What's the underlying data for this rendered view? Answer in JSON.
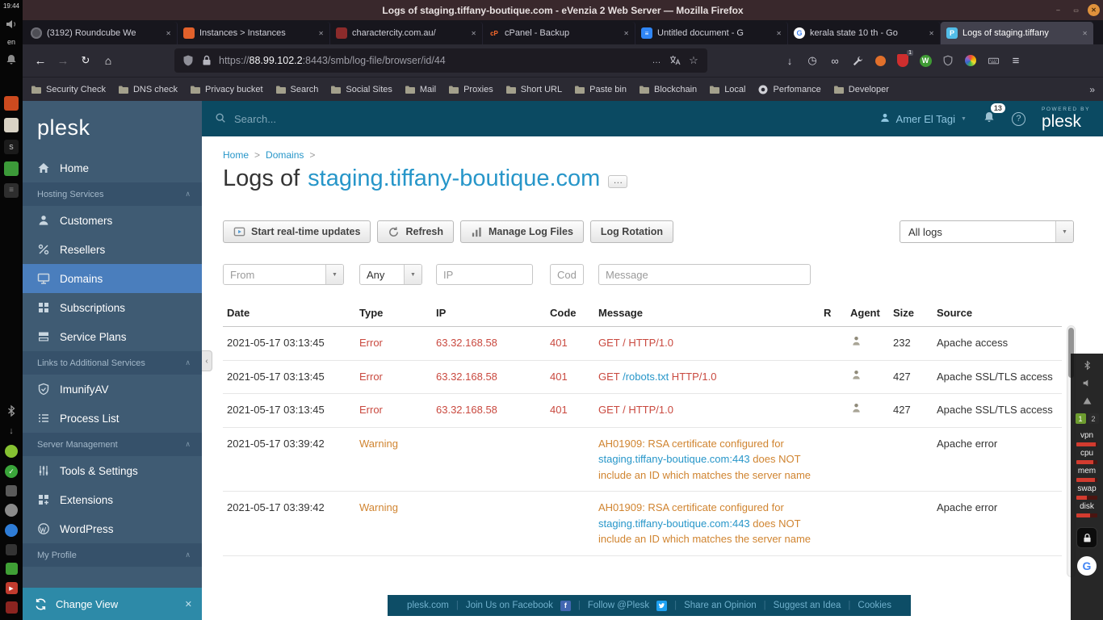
{
  "system": {
    "clock": "19:44",
    "keyboard_language": "en",
    "workspaces": [
      "1",
      "2"
    ],
    "monitor_labels": [
      "vpn",
      "cpu",
      "mem",
      "swap",
      "disk"
    ]
  },
  "browser": {
    "window_title": "Logs of staging.tiffany-boutique.com - eVenzia 2 Web Server — Mozilla Firefox",
    "tabs": [
      {
        "icon": "roundcube",
        "label": "(3192) Roundcube We"
      },
      {
        "icon": "instances",
        "label": "Instances > Instances"
      },
      {
        "icon": "charactercity",
        "label": "charactercity.com.au/"
      },
      {
        "icon": "cpanel",
        "label": "cPanel - Backup"
      },
      {
        "icon": "gdocs",
        "label": "Untitled document - G"
      },
      {
        "icon": "google",
        "label": "kerala state 10 th - Go"
      },
      {
        "icon": "plesk",
        "label": "Logs of staging.tiffany",
        "active": true
      }
    ],
    "url": {
      "scheme": "https://",
      "host": "88.99.102.2",
      "rest": ":8443/smb/log-file/browser/id/44"
    },
    "ublock_badge": "1",
    "bookmarks": [
      {
        "icon": "folder",
        "label": "Security Check"
      },
      {
        "icon": "folder",
        "label": "DNS check"
      },
      {
        "icon": "folder",
        "label": "Privacy bucket"
      },
      {
        "icon": "folder",
        "label": "Search"
      },
      {
        "icon": "folder",
        "label": "Social Sites"
      },
      {
        "icon": "folder",
        "label": "Mail"
      },
      {
        "icon": "folder",
        "label": "Proxies"
      },
      {
        "icon": "folder",
        "label": "Short URL"
      },
      {
        "icon": "folder",
        "label": "Paste bin"
      },
      {
        "icon": "folder",
        "label": "Blockchain"
      },
      {
        "icon": "folder",
        "label": "Local"
      },
      {
        "icon": "github",
        "label": "Perfomance"
      },
      {
        "icon": "folder",
        "label": "Developer"
      }
    ]
  },
  "plesk": {
    "brand": "plesk",
    "sidebar": [
      {
        "type": "item",
        "icon": "home",
        "label": "Home"
      },
      {
        "type": "section",
        "label": "Hosting Services"
      },
      {
        "type": "item",
        "icon": "customers",
        "label": "Customers"
      },
      {
        "type": "item",
        "icon": "resellers",
        "label": "Resellers"
      },
      {
        "type": "item",
        "icon": "domains",
        "label": "Domains",
        "active": true
      },
      {
        "type": "item",
        "icon": "subscriptions",
        "label": "Subscriptions"
      },
      {
        "type": "item",
        "icon": "plans",
        "label": "Service Plans"
      },
      {
        "type": "section",
        "label": "Links to Additional Services"
      },
      {
        "type": "item",
        "icon": "imunify",
        "label": "ImunifyAV"
      },
      {
        "type": "item",
        "icon": "process",
        "label": "Process List"
      },
      {
        "type": "section",
        "label": "Server Management"
      },
      {
        "type": "item",
        "icon": "tools",
        "label": "Tools & Settings"
      },
      {
        "type": "item",
        "icon": "extensions",
        "label": "Extensions"
      },
      {
        "type": "item",
        "icon": "wordpress",
        "label": "WordPress"
      },
      {
        "type": "section",
        "label": "My Profile"
      }
    ],
    "change_view_label": "Change View",
    "header": {
      "search_placeholder": "Search...",
      "user_name": "Amer El Tagi",
      "notification_count": "13",
      "powered_by": "POWERED BY",
      "powered_brand": "plesk"
    },
    "breadcrumb": [
      {
        "label": "Home"
      },
      {
        "label": "Domains"
      }
    ],
    "page_title": {
      "prefix": "Logs of",
      "domain": "staging.tiffany-boutique.com"
    },
    "toolbar_buttons": [
      {
        "icon": "realtime",
        "label": "Start real-time updates"
      },
      {
        "icon": "refresh",
        "label": "Refresh"
      },
      {
        "icon": "managelogs",
        "label": "Manage Log Files"
      },
      {
        "icon": null,
        "label": "Log Rotation"
      }
    ],
    "log_type_select": {
      "value": "All logs"
    },
    "filter_placeholders": {
      "from": "From",
      "type": "Any",
      "ip": "IP",
      "code": "Code",
      "message": "Message"
    },
    "table": {
      "headers": [
        "Date",
        "Type",
        "IP",
        "Code",
        "Message",
        "R",
        "Agent",
        "Size",
        "Source"
      ],
      "rows": [
        {
          "date": "2021-05-17 03:13:45",
          "level": "error",
          "type": "Error",
          "ip": "63.32.168.58",
          "code": "401",
          "message": [
            {
              "style": "error",
              "text": "GET / HTTP/1.0"
            }
          ],
          "agent": true,
          "size": "232",
          "source": "Apache access"
        },
        {
          "date": "2021-05-17 03:13:45",
          "level": "error",
          "type": "Error",
          "ip": "63.32.168.58",
          "code": "401",
          "message": [
            {
              "style": "error",
              "text": "GET "
            },
            {
              "style": "link",
              "text": "/robots.txt"
            },
            {
              "style": "error",
              "text": " HTTP/1.0"
            }
          ],
          "agent": true,
          "size": "427",
          "source": "Apache SSL/TLS access"
        },
        {
          "date": "2021-05-17 03:13:45",
          "level": "error",
          "type": "Error",
          "ip": "63.32.168.58",
          "code": "401",
          "message": [
            {
              "style": "error",
              "text": "GET / HTTP/1.0"
            }
          ],
          "agent": true,
          "size": "427",
          "source": "Apache SSL/TLS access"
        },
        {
          "date": "2021-05-17 03:39:42",
          "level": "warning",
          "type": "Warning",
          "ip": "",
          "code": "",
          "message": [
            {
              "style": "warning",
              "text": "AH01909: RSA certificate configured for "
            },
            {
              "style": "link",
              "text": "staging.tiffany-boutique.com:443"
            },
            {
              "style": "warning",
              "text": " does NOT include an ID which matches the server name"
            }
          ],
          "agent": false,
          "size": "",
          "source": "Apache error"
        },
        {
          "date": "2021-05-17 03:39:42",
          "level": "warning",
          "type": "Warning",
          "ip": "",
          "code": "",
          "message": [
            {
              "style": "warning",
              "text": "AH01909: RSA certificate configured for "
            },
            {
              "style": "link",
              "text": "staging.tiffany-boutique.com:443"
            },
            {
              "style": "warning",
              "text": " does NOT include an ID which matches the server name"
            }
          ],
          "agent": false,
          "size": "",
          "source": "Apache error"
        }
      ]
    },
    "footer": {
      "links": [
        {
          "label": "plesk.com"
        },
        {
          "label": "Join Us on Facebook",
          "icon": "facebook"
        },
        {
          "label": "Follow @Plesk",
          "icon": "twitter"
        },
        {
          "label": "Share an Opinion"
        },
        {
          "label": "Suggest an Idea"
        },
        {
          "label": "Cookies"
        }
      ]
    }
  }
}
